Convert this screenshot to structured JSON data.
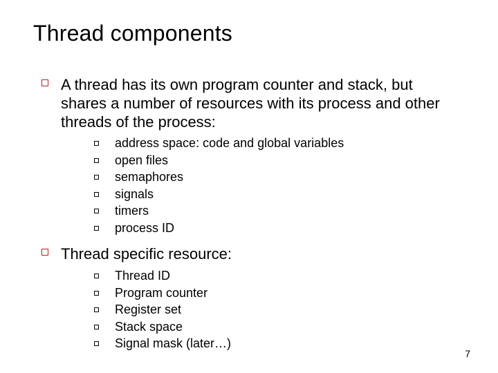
{
  "title": "Thread components",
  "sections": [
    {
      "text": "A thread has its own program counter and stack, but shares a number of resources with its process and other threads of the process:",
      "items": [
        "address space: code and global variables",
        "open files",
        "semaphores",
        "signals",
        "timers",
        "process ID"
      ]
    },
    {
      "text": "Thread specific resource:",
      "items": [
        "Thread ID",
        "Program counter",
        "Register set",
        "Stack space",
        "Signal mask (later…)"
      ]
    }
  ],
  "page_number": "7"
}
